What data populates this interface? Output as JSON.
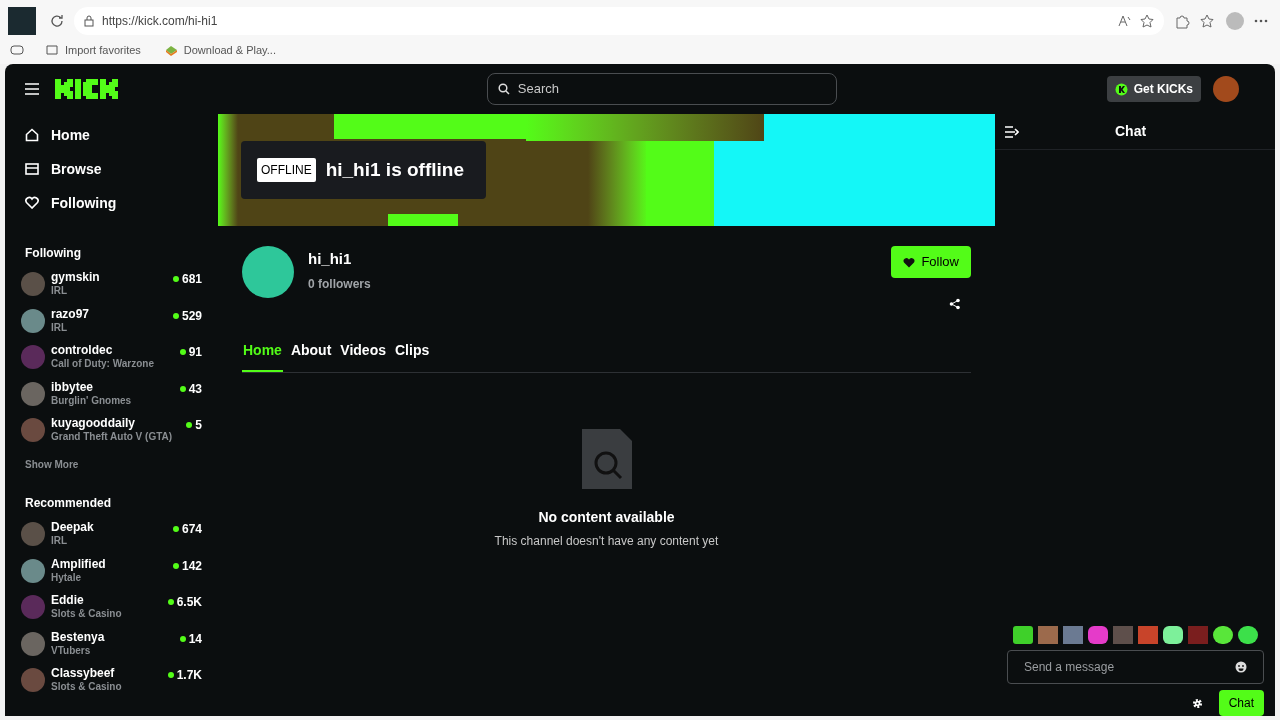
{
  "browser": {
    "url": "https://kick.com/hi-hi1",
    "bookmarks": [
      "Import favorites",
      "Download & Play..."
    ]
  },
  "header": {
    "search_placeholder": "Search",
    "get_kicks": "Get KICKs"
  },
  "nav": [
    "Home",
    "Browse",
    "Following"
  ],
  "following": {
    "title": "Following",
    "channels": [
      {
        "name": "gymskin",
        "category": "IRL",
        "viewers": "681"
      },
      {
        "name": "razo97",
        "category": "IRL",
        "viewers": "529"
      },
      {
        "name": "controldec",
        "category": "Call of Duty: Warzone",
        "viewers": "91"
      },
      {
        "name": "ibbytee",
        "category": "Burglin' Gnomes",
        "viewers": "43"
      },
      {
        "name": "kuyagooddaily",
        "category": "Grand Theft Auto V (GTA)",
        "viewers": "5"
      }
    ],
    "show_more": "Show More"
  },
  "recommended": {
    "title": "Recommended",
    "channels": [
      {
        "name": "Deepak",
        "category": "IRL",
        "viewers": "674"
      },
      {
        "name": "Amplified",
        "category": "Hytale",
        "viewers": "142"
      },
      {
        "name": "Eddie",
        "category": "Slots & Casino",
        "viewers": "6.5K"
      },
      {
        "name": "Bestenya",
        "category": "VTubers",
        "viewers": "14"
      },
      {
        "name": "Classybeef",
        "category": "Slots & Casino",
        "viewers": "1.7K"
      }
    ]
  },
  "channel": {
    "badge": "OFFLINE",
    "offline_text": "hi_hi1 is offline",
    "name": "hi_hi1",
    "followers": "0 followers",
    "follow_button": "Follow",
    "tabs": [
      {
        "label": "Home",
        "selected": true
      },
      {
        "label": "About",
        "selected": false
      },
      {
        "label": "Videos",
        "selected": false
      },
      {
        "label": "Clips",
        "selected": false
      }
    ],
    "empty_title": "No content available",
    "empty_subtitle": "This channel doesn't have any content yet"
  },
  "chat": {
    "title": "Chat",
    "placeholder": "Send a message",
    "send_button": "Chat"
  }
}
